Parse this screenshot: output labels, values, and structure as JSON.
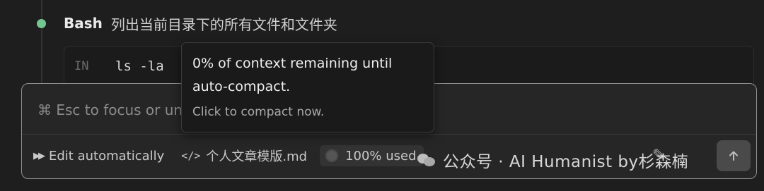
{
  "step": {
    "tool_name": "Bash",
    "description": "列出当前目录下的所有文件和文件夹",
    "status_color": "#74c691"
  },
  "code": {
    "label": "IN",
    "command": "ls -la"
  },
  "composer": {
    "placeholder": "⌘ Esc to focus or unfocus Claude"
  },
  "bottom_bar": {
    "edit_mode_icon": "fast-forward-icon",
    "edit_mode_label": "Edit automatically",
    "file_icon": "code-brackets-icon",
    "file_label": "个人文章模版.md",
    "context_label": "100% used"
  },
  "tooltip": {
    "line1": "0% of context remaining until",
    "line2": "auto-compact.",
    "action": "Click to compact now."
  },
  "watermark": {
    "text": "公众号 · AI Humanist by杉森楠"
  }
}
